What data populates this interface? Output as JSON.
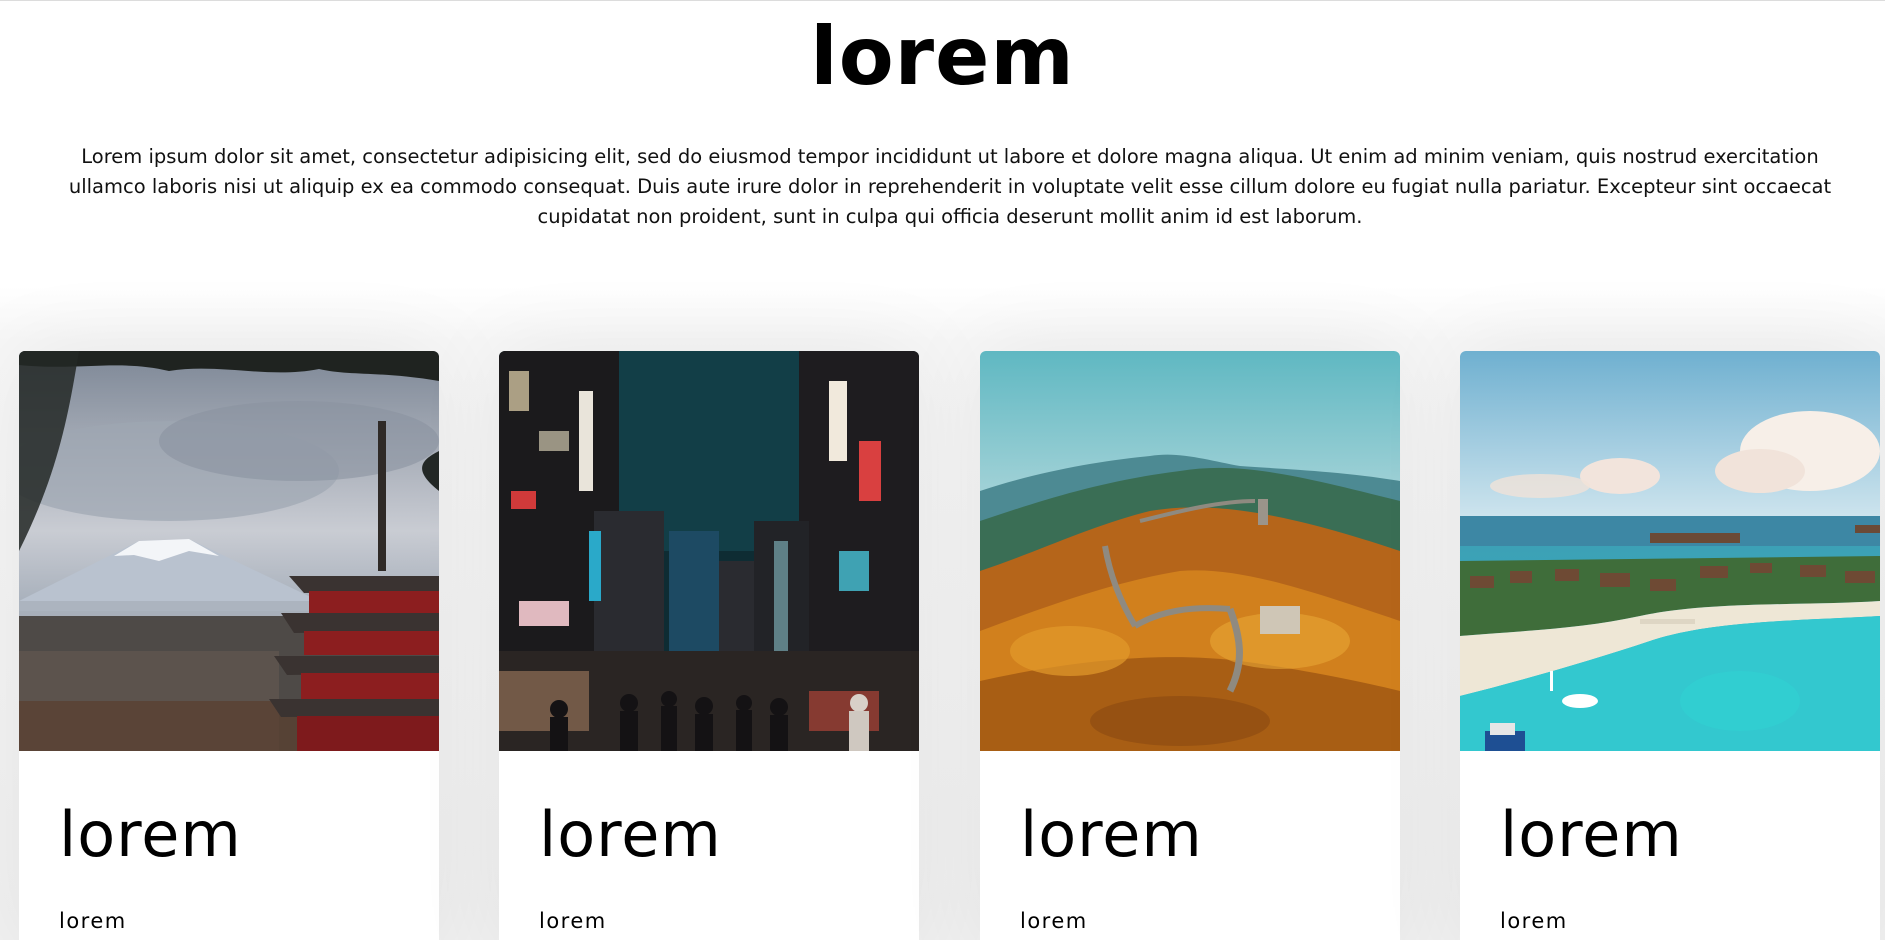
{
  "header": {
    "title": "lorem",
    "description": "Lorem ipsum dolor sit amet, consectetur adipisicing elit, sed do eiusmod tempor incididunt ut labore et dolore magna aliqua. Ut enim ad minim veniam, quis nostrud exercitation ullamco laboris nisi ut aliquip ex ea commodo consequat. Duis aute irure dolor in reprehenderit in voluptate velit esse cillum dolore eu fugiat nulla pariatur. Excepteur sint occaecat cupidatat non proident, sunt in culpa qui officia deserunt mollit anim id est laborum."
  },
  "cards": [
    {
      "title": "lorem",
      "subtitle": "lorem"
    },
    {
      "title": "lorem",
      "subtitle": "lorem"
    },
    {
      "title": "lorem",
      "subtitle": "lorem"
    },
    {
      "title": "lorem",
      "subtitle": "lorem"
    }
  ]
}
